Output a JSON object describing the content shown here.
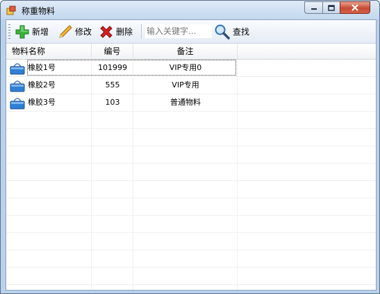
{
  "window": {
    "title": "称重物料"
  },
  "icons": {
    "app": "app-window-icon",
    "add": "plus-icon",
    "edit": "pencil-icon",
    "delete": "x-delete-icon",
    "search": "magnifier-icon",
    "row": "basket-icon"
  },
  "toolbar": {
    "add_label": "新增",
    "edit_label": "修改",
    "delete_label": "删除",
    "search_placeholder": "输入关键字...",
    "search_label": "查找"
  },
  "table": {
    "columns": [
      "物料名称",
      "编号",
      "备注"
    ],
    "rows": [
      {
        "name": "橡胶1号",
        "code": "101999",
        "remark": "VIP专用0"
      },
      {
        "name": "橡胶2号",
        "code": "555",
        "remark": "VIP专用"
      },
      {
        "name": "橡胶3号",
        "code": "103",
        "remark": "普通物料"
      }
    ]
  }
}
